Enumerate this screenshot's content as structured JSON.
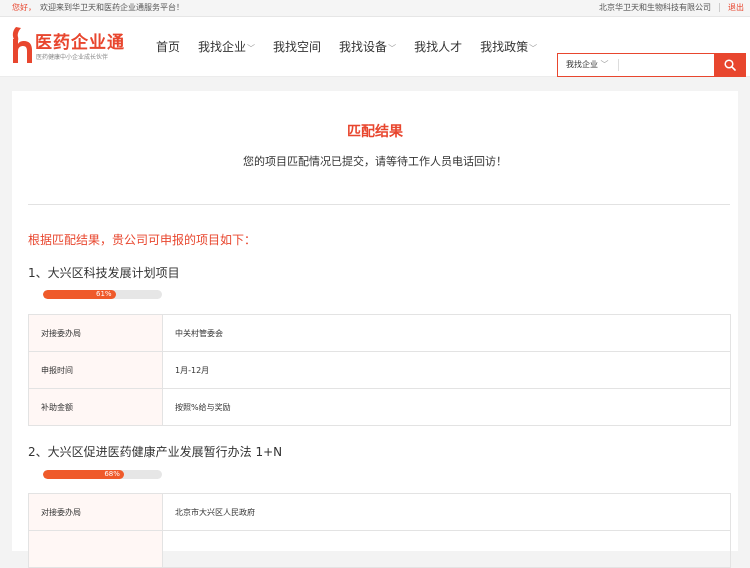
{
  "topbar": {
    "greeting": "您好，",
    "welcome": "欢迎来到华卫天和医药企业通服务平台！",
    "company": "北京华卫天和生物科技有限公司",
    "logout": "退出"
  },
  "logo": {
    "name": "医药企业通",
    "slogan": "医药健康中小企业成长伙伴"
  },
  "nav": [
    {
      "label": "首页",
      "has_dropdown": false
    },
    {
      "label": "我找企业",
      "has_dropdown": true
    },
    {
      "label": "我找空间",
      "has_dropdown": false
    },
    {
      "label": "我找设备",
      "has_dropdown": true
    },
    {
      "label": "我找人才",
      "has_dropdown": false
    },
    {
      "label": "我找政策",
      "has_dropdown": true
    }
  ],
  "search": {
    "selected": "我找企业",
    "value": "",
    "placeholder": "",
    "icon": "search-icon"
  },
  "result": {
    "title": "匹配结果",
    "subtitle": "您的项目匹配情况已提交，请等待工作人员电话回访！",
    "intro": "根据匹配结果，贵公司可申报的项目如下："
  },
  "projects": [
    {
      "title": "1、大兴区科技发展计划项目",
      "match_pct": 61,
      "match_label": "61%",
      "rows": [
        {
          "k": "对接委办局",
          "v": "中关村管委会"
        },
        {
          "k": "申报时间",
          "v": "1月-12月"
        },
        {
          "k": "补助金额",
          "v": "按照%给与奖励"
        }
      ]
    },
    {
      "title": "2、大兴区促进医药健康产业发展暂行办法 1+N",
      "match_pct": 68,
      "match_label": "68%",
      "rows": [
        {
          "k": "对接委办局",
          "v": "北京市大兴区人民政府"
        }
      ]
    }
  ],
  "colors": {
    "accent": "#e8462e",
    "progress": "#ef5a2a"
  }
}
